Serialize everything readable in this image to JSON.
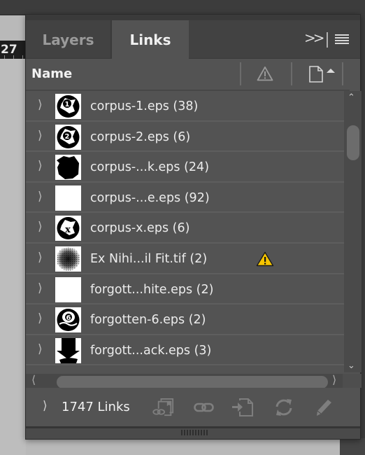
{
  "app": {
    "ruler_value": "27"
  },
  "panel": {
    "tabs": [
      {
        "label": "Layers",
        "active": false
      },
      {
        "label": "Links",
        "active": true
      }
    ],
    "header": {
      "name_column": "Name",
      "status_icon": "warning-icon",
      "page_icon": "page-icon",
      "sort": "ascending"
    },
    "links": [
      {
        "name": "corpus-1.eps (38)",
        "thumb": "circle-1",
        "warning": false
      },
      {
        "name": "corpus-2.eps (6)",
        "thumb": "circle-2",
        "warning": false
      },
      {
        "name": "corpus-...k.eps (24)",
        "thumb": "black-blob",
        "warning": false
      },
      {
        "name": "corpus-...e.eps (92)",
        "thumb": "white",
        "warning": false
      },
      {
        "name": "corpus-x.eps (6)",
        "thumb": "circle-x",
        "warning": false
      },
      {
        "name": "Ex Nihi...il Fit.tif (2)",
        "thumb": "noise",
        "warning": true
      },
      {
        "name": "forgott...hite.eps (2)",
        "thumb": "white",
        "warning": false
      },
      {
        "name": "forgotten-6.eps (2)",
        "thumb": "circle-6",
        "warning": false
      },
      {
        "name": "forgott...ack.eps (3)",
        "thumb": "black-arrow",
        "warning": false
      }
    ],
    "footer": {
      "count_label": "1747 Links",
      "actions": [
        "relink-from-cc-libraries",
        "relink",
        "go-to-link",
        "update-link",
        "edit-original"
      ]
    },
    "colors": {
      "warning": "#f5c400"
    }
  }
}
